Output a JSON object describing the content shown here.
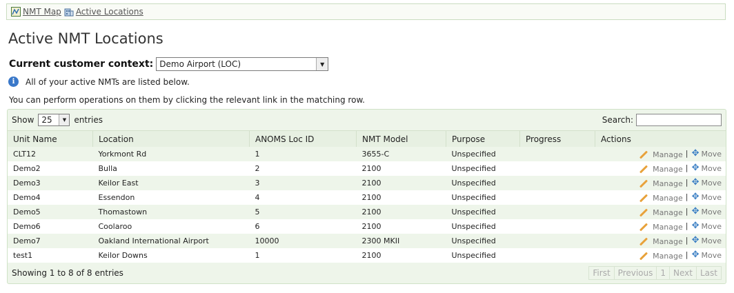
{
  "breadcrumb": [
    {
      "label": "NMT Map",
      "icon": "map-icon"
    },
    {
      "label": "Active Locations",
      "icon": "building-icon"
    }
  ],
  "page_title": "Active NMT Locations",
  "context": {
    "label": "Current customer context:",
    "value": "Demo Airport (LOC)"
  },
  "info_text": "All of your active NMTs are listed below.",
  "description": "You can perform operations on them by clicking the relevant link in the matching row.",
  "table_controls": {
    "show_label": "Show",
    "page_size": "25",
    "entries_label": "entries",
    "search_label": "Search:"
  },
  "columns": [
    "Unit Name",
    "Location",
    "ANOMS Loc ID",
    "NMT Model",
    "Purpose",
    "Progress",
    "Actions"
  ],
  "rows": [
    {
      "unit": "CLT12",
      "location": "Yorkmont Rd",
      "loc_id": "1",
      "model": "3655-C",
      "purpose": "Unspecified",
      "progress": ""
    },
    {
      "unit": "Demo2",
      "location": "Bulla",
      "loc_id": "2",
      "model": "2100",
      "purpose": "Unspecified",
      "progress": ""
    },
    {
      "unit": "Demo3",
      "location": "Keilor East",
      "loc_id": "3",
      "model": "2100",
      "purpose": "Unspecified",
      "progress": ""
    },
    {
      "unit": "Demo4",
      "location": "Essendon",
      "loc_id": "4",
      "model": "2100",
      "purpose": "Unspecified",
      "progress": ""
    },
    {
      "unit": "Demo5",
      "location": "Thomastown",
      "loc_id": "5",
      "model": "2100",
      "purpose": "Unspecified",
      "progress": ""
    },
    {
      "unit": "Demo6",
      "location": "Coolaroo",
      "loc_id": "6",
      "model": "2100",
      "purpose": "Unspecified",
      "progress": ""
    },
    {
      "unit": "Demo7",
      "location": "Oakland International Airport",
      "loc_id": "10000",
      "model": "2300 MKII",
      "purpose": "Unspecified",
      "progress": ""
    },
    {
      "unit": "test1",
      "location": "Keilor Downs",
      "loc_id": "1",
      "model": "2100",
      "purpose": "Unspecified",
      "progress": ""
    }
  ],
  "actions": {
    "manage": "Manage",
    "move": "Move",
    "separator": "|"
  },
  "footer_info": "Showing 1 to 8 of 8 entries",
  "pager": [
    "First",
    "Previous",
    "1",
    "Next",
    "Last"
  ]
}
